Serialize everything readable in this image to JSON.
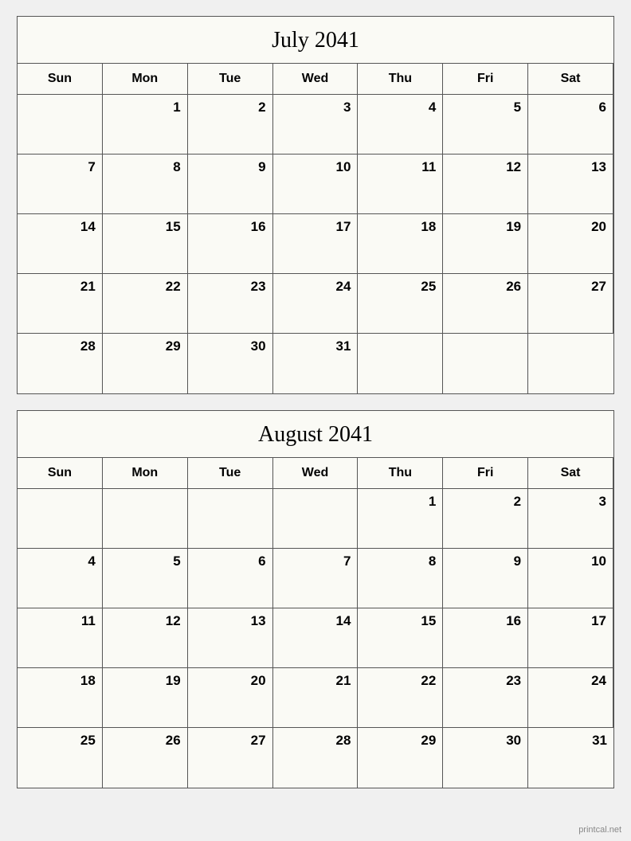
{
  "calendars": [
    {
      "id": "july-2041",
      "title": "July 2041",
      "headers": [
        "Sun",
        "Mon",
        "Tue",
        "Wed",
        "Thu",
        "Fri",
        "Sat"
      ],
      "weeks": [
        [
          "",
          "1",
          "2",
          "3",
          "4",
          "5",
          "6"
        ],
        [
          "7",
          "8",
          "9",
          "10",
          "11",
          "12",
          "13"
        ],
        [
          "14",
          "15",
          "16",
          "17",
          "18",
          "19",
          "20"
        ],
        [
          "21",
          "22",
          "23",
          "24",
          "25",
          "26",
          "27"
        ],
        [
          "28",
          "29",
          "30",
          "31",
          "",
          "",
          ""
        ]
      ]
    },
    {
      "id": "august-2041",
      "title": "August 2041",
      "headers": [
        "Sun",
        "Mon",
        "Tue",
        "Wed",
        "Thu",
        "Fri",
        "Sat"
      ],
      "weeks": [
        [
          "",
          "",
          "",
          "",
          "1",
          "2",
          "3"
        ],
        [
          "4",
          "5",
          "6",
          "7",
          "8",
          "9",
          "10"
        ],
        [
          "11",
          "12",
          "13",
          "14",
          "15",
          "16",
          "17"
        ],
        [
          "18",
          "19",
          "20",
          "21",
          "22",
          "23",
          "24"
        ],
        [
          "25",
          "26",
          "27",
          "28",
          "29",
          "30",
          "31"
        ]
      ]
    }
  ],
  "watermark": "printcal.net"
}
